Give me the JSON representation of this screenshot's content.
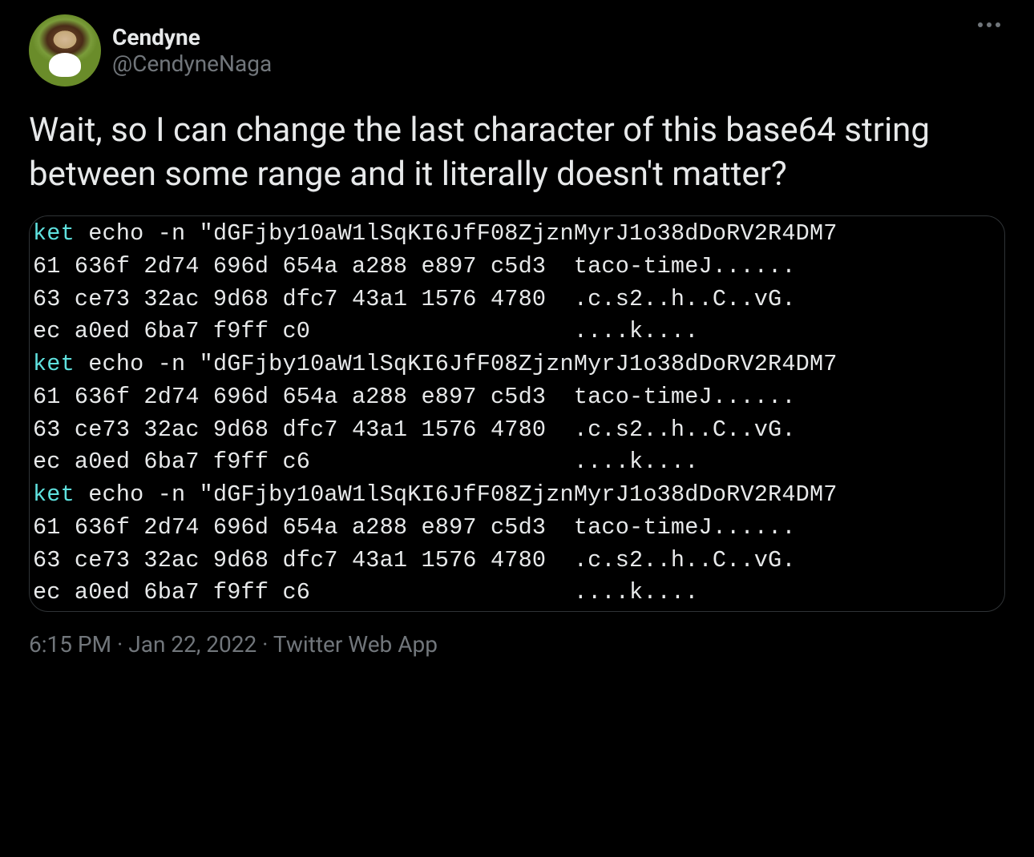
{
  "user": {
    "display_name": "Cendyne",
    "handle": "@CendyneNaga"
  },
  "tweet_text": "Wait, so I can change the last character of this base64 string between some range and it literally doesn't matter?",
  "terminal": {
    "blocks": [
      {
        "prompt": "ket",
        "cmd": " echo -n \"dGFjby10aW1lSqKI6JfF08ZjznMyrJ1o38dDoRV2R4DM7",
        "lines": [
          "61 636f 2d74 696d 654a a288 e897 c5d3  taco-timeJ......",
          "63 ce73 32ac 9d68 dfc7 43a1 1576 4780  .c.s2..h..C..vG.",
          "ec a0ed 6ba7 f9ff c0                   ....k...."
        ]
      },
      {
        "prompt": "ket",
        "cmd": " echo -n \"dGFjby10aW1lSqKI6JfF08ZjznMyrJ1o38dDoRV2R4DM7",
        "lines": [
          "61 636f 2d74 696d 654a a288 e897 c5d3  taco-timeJ......",
          "63 ce73 32ac 9d68 dfc7 43a1 1576 4780  .c.s2..h..C..vG.",
          "ec a0ed 6ba7 f9ff c6                   ....k...."
        ]
      },
      {
        "prompt": "ket",
        "cmd": " echo -n \"dGFjby10aW1lSqKI6JfF08ZjznMyrJ1o38dDoRV2R4DM7",
        "lines": [
          "61 636f 2d74 696d 654a a288 e897 c5d3  taco-timeJ......",
          "63 ce73 32ac 9d68 dfc7 43a1 1576 4780  .c.s2..h..C..vG.",
          "ec a0ed 6ba7 f9ff c6                   ....k...."
        ]
      }
    ]
  },
  "meta": {
    "time": "6:15 PM",
    "date": "Jan 22, 2022",
    "source": "Twitter Web App",
    "separator": " · "
  },
  "colors": {
    "background": "#000000",
    "text_primary": "#e7e9ea",
    "text_secondary": "#71767b",
    "border": "#2f3336",
    "prompt": "#5fe1de"
  }
}
